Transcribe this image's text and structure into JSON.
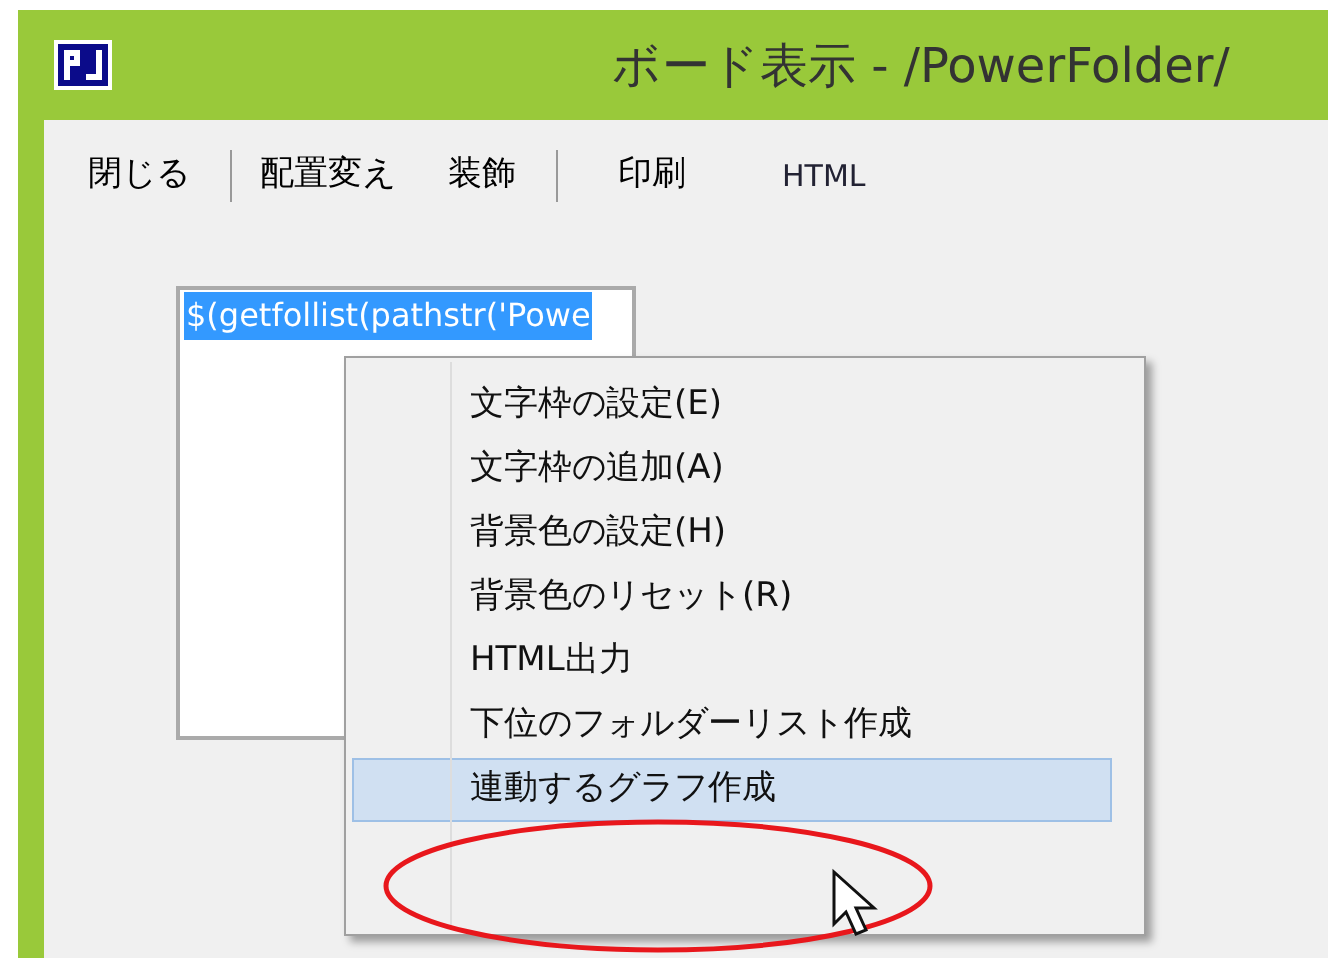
{
  "window": {
    "title": "ボード表示 - /PowerFolder/"
  },
  "toolbar": {
    "groups": [
      [
        {
          "label": "閉じる",
          "kind": "text"
        }
      ],
      [
        {
          "label": "配置変え",
          "kind": "text"
        },
        {
          "label": "装飾",
          "kind": "text"
        }
      ],
      [
        {
          "label": "印刷",
          "kind": "text"
        },
        {
          "label": "HTML",
          "kind": "link"
        }
      ]
    ]
  },
  "text_box": {
    "lines": [
      {
        "text": "$(getfollist(pathstr('Powe",
        "selected": true
      }
    ]
  },
  "context_menu": {
    "items": [
      {
        "label": "文字枠の設定(E)",
        "selected": false
      },
      {
        "label": "文字枠の追加(A)",
        "selected": false
      },
      {
        "label": "背景色の設定(H)",
        "selected": false
      },
      {
        "label": "背景色のリセット(R)",
        "selected": false
      },
      {
        "label": "HTML出力",
        "selected": false
      },
      {
        "label": "下位のフォルダーリスト作成",
        "selected": false
      },
      {
        "label": "連動するグラフ作成",
        "selected": true
      }
    ]
  }
}
